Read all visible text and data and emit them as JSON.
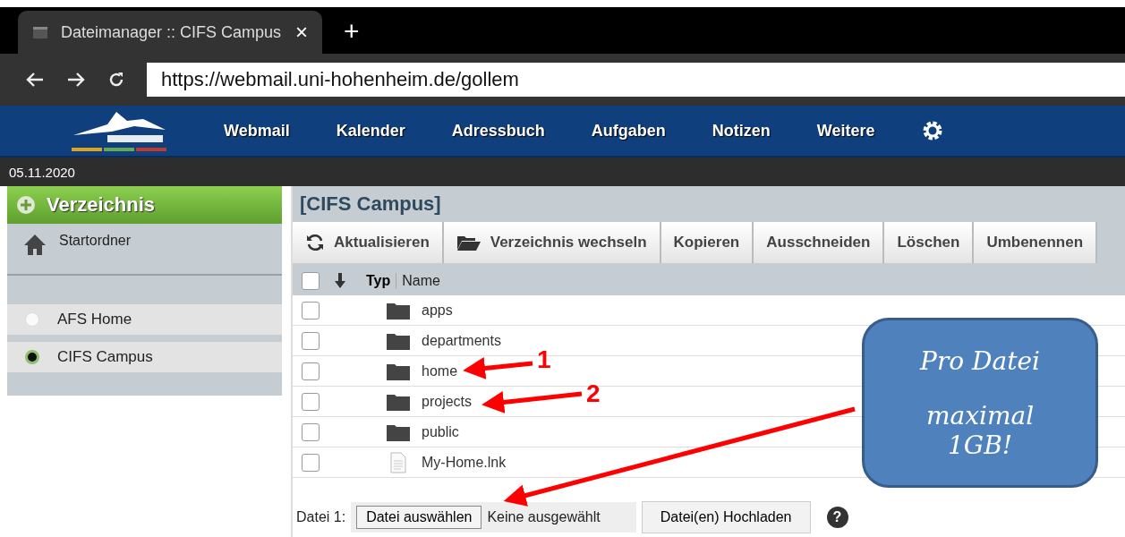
{
  "browser": {
    "tab_title": "Dateimanager :: CIFS Campus",
    "close": "×",
    "new_tab": "+",
    "address": "https://webmail.uni-hohenheim.de/gollem"
  },
  "nav": {
    "items": [
      "Webmail",
      "Kalender",
      "Adressbuch",
      "Aufgaben",
      "Notizen",
      "Weitere"
    ]
  },
  "date": "05.11.2020",
  "sidebar": {
    "header": "Verzeichnis",
    "home": "Startordner",
    "backends": [
      {
        "label": "AFS Home",
        "selected": false
      },
      {
        "label": "CIFS Campus",
        "selected": true
      }
    ]
  },
  "main": {
    "title": "[CIFS Campus]",
    "toolbar": [
      {
        "label": "Aktualisieren",
        "kind": "refresh"
      },
      {
        "label": "Verzeichnis wechseln",
        "kind": "folder"
      },
      {
        "label": "Kopieren",
        "kind": "plain"
      },
      {
        "label": "Ausschneiden",
        "kind": "plain"
      },
      {
        "label": "Löschen",
        "kind": "plain"
      },
      {
        "label": "Umbenennen",
        "kind": "plain"
      }
    ],
    "columns": {
      "type": "Typ",
      "name": "Name",
      "select_all_checked": false
    },
    "rows": [
      {
        "name": "apps",
        "kind": "folder",
        "checked": false
      },
      {
        "name": "departments",
        "kind": "folder",
        "checked": false
      },
      {
        "name": "home",
        "kind": "folder",
        "checked": false
      },
      {
        "name": "projects",
        "kind": "folder",
        "checked": false
      },
      {
        "name": "public",
        "kind": "folder",
        "checked": false
      },
      {
        "name": "My-Home.lnk",
        "kind": "file",
        "checked": false
      }
    ],
    "upload": {
      "label": "Datei 1:",
      "choose": "Datei auswählen",
      "status": "Keine ausgewählt",
      "submit": "Datei(en) Hochladen",
      "help": "?"
    }
  },
  "annotations": {
    "markers": [
      "1",
      "2"
    ],
    "callout": [
      "Pro Datei",
      "maximal 1GB!"
    ]
  }
}
